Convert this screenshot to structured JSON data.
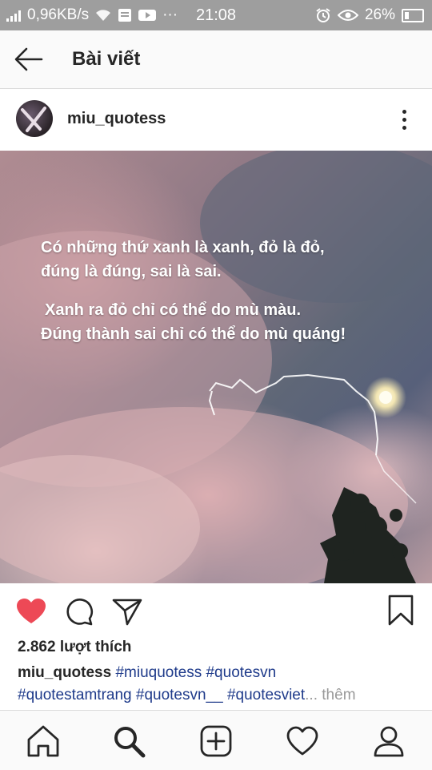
{
  "status_bar": {
    "speed": "0,96KB/s",
    "time": "21:08",
    "battery": "26%"
  },
  "app_bar": {
    "title": "Bài viết",
    "back_icon": "arrow-left-icon"
  },
  "post": {
    "username": "miu_quotess",
    "menu_icon": "more-vertical-icon",
    "image_text": {
      "line1": "Có những thứ xanh là xanh, đỏ là đỏ,",
      "line2": "đúng là đúng, sai là sai.",
      "line3": "Xanh ra đỏ chỉ có thể do mù màu.",
      "line4": "Đúng thành sai chỉ có thể do mù quáng!"
    },
    "likes": "2.862 lượt thích",
    "caption": {
      "username": "miu_quotess",
      "tags_line1": "#miuquotess #quotesvn",
      "tags_line2": "#quotestamtrang #quotesvn__ #quotesviet",
      "ellipsis": "...",
      "more": "thêm"
    },
    "liked": true,
    "like_color": "#ed4956"
  },
  "actions": {
    "like_icon": "heart-filled-icon",
    "comment_icon": "comment-icon",
    "share_icon": "send-icon",
    "save_icon": "bookmark-icon"
  },
  "bottom_nav": {
    "items": [
      "home-icon",
      "search-icon",
      "add-post-icon",
      "activity-heart-icon",
      "profile-icon"
    ]
  }
}
